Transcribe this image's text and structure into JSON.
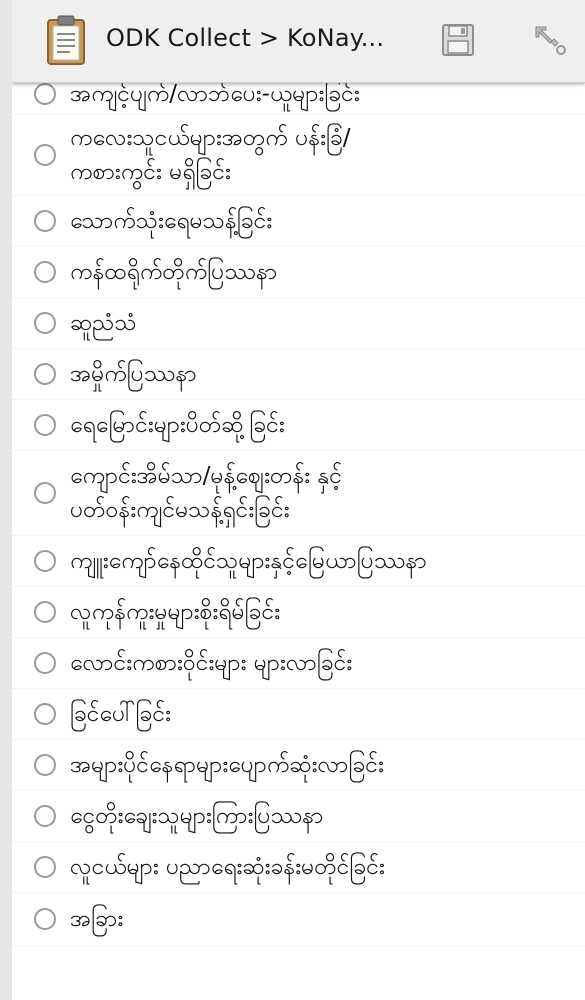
{
  "actionbar": {
    "title": "ODK Collect > KoNay...",
    "app_icon": "clipboard-icon",
    "save_icon": "save-icon",
    "nav_icon": "goto-arrow-icon"
  },
  "options": [
    "အကျင့်ပျက်/လာဘ်ပေး-ယူများခြင်း",
    "ကလေးသူငယ်များအတွက် ပန်းခြံ/\nကစားကွင်း မရှိခြင်း",
    "သောက်သုံးရေမသန့်ခြင်း",
    "ကန်ထရိုက်တိုက်ပြဿနာ",
    "ဆူညံသံ",
    "အမှိုက်ပြဿနာ",
    "ရေမြောင်းများပိတ်ဆို့ခြင်း",
    "ကျောင်းအိမ်သာ/မုန့်ဈေးတန်း နှင့်\nပတ်ဝန်းကျင်မသန့်ရှင်းခြင်း",
    "ကျူးကျော်နေထိုင်သူများနှင့်မြေယာပြဿနာ",
    "လူကုန်ကူးမှုများစိုးရိမ်ခြင်း",
    "လောင်းကစားဝိုင်းများ များလာခြင်း",
    "ခြင်ပေါ်ခြင်း",
    "အများပိုင်နေရာများပျောက်ဆုံးလာခြင်း",
    "ငွေတိုးချေးသူများကြားပြဿနာ",
    "လူငယ်များ ပညာရေးဆုံးခန်းမတိုင်ခြင်း",
    "အခြား"
  ]
}
